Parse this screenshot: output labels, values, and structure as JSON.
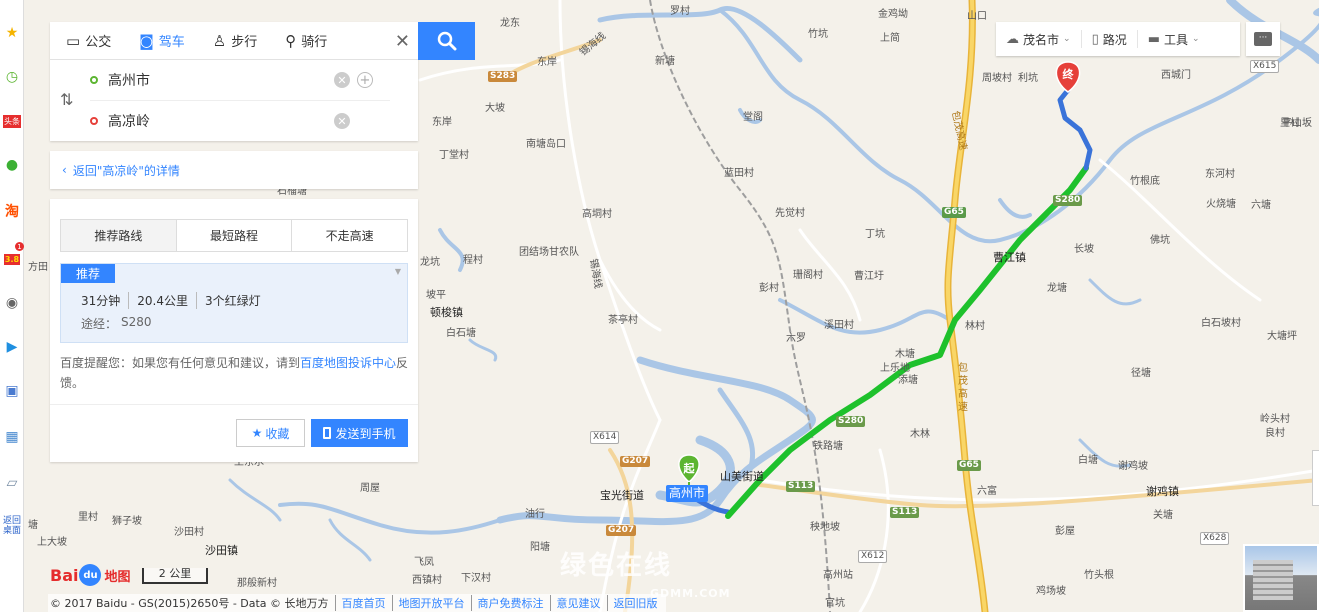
{
  "tabs": {
    "bus": "公交",
    "drive": "驾车",
    "walk": "步行",
    "bike": "骑行"
  },
  "inputs": {
    "origin": "高州市",
    "destination": "高凉岭"
  },
  "back_link": "返回\"高凉岭\"的详情",
  "route_tabs": [
    "推荐路线",
    "最短路程",
    "不走高速"
  ],
  "route": {
    "badge": "推荐",
    "duration": "31分钟",
    "distance": "20.4公里",
    "lights": "3个红绿灯",
    "via_label": "途经：",
    "via_road": "S280"
  },
  "tip": {
    "prefix": "百度提醒您：如果您有任何意见和建议，请到",
    "link": "百度地图投诉中心",
    "suffix": "反馈。"
  },
  "buttons": {
    "favorite": "收藏",
    "send_to_phone": "发送到手机"
  },
  "toolbar": {
    "city": "茂名市",
    "traffic": "路况",
    "tools": "工具"
  },
  "markers": {
    "start": "起",
    "end": "终",
    "origin_label": "高州市"
  },
  "dock": {
    "notice_count": "1",
    "promo": "3.8",
    "taobao": "淘",
    "news": "头条",
    "desktop": "返回桌面"
  },
  "logo": {
    "brand_left": "Bai",
    "brand_paw": "du",
    "brand_right": "地图"
  },
  "scale": "2 公里",
  "footer": {
    "copyright": "© 2017 Baidu - GS(2015)2650号 - Data © 长地万方",
    "links": [
      "百度首页",
      "地图开放平台",
      "商户免费标注",
      "意见建议",
      "返回旧版"
    ]
  },
  "watermark": {
    "main": "绿色在线",
    "sub": "GDMM.COM"
  },
  "map_labels": {
    "towns": [
      "曹江镇",
      "顿梭镇",
      "宝光街道",
      "山美街道",
      "沙田镇",
      "谢鸡镇",
      "高州站"
    ],
    "places": [
      "龙东",
      "罗村",
      "竹坑",
      "金鸡坳",
      "山口",
      "上简",
      "东岸",
      "新塘",
      "大坡",
      "南塘岛口",
      "东岸",
      "丁堂村",
      "石榴塘",
      "堂阁",
      "蓝田村",
      "先觉村",
      "高垌村",
      "团结场甘农队",
      "程村",
      "茶亭村",
      "坡平",
      "白石塘",
      "丁坑",
      "珊阁村",
      "曹江圩",
      "彭村",
      "六罗",
      "溪田村",
      "木塘",
      "上乐地",
      "添塘",
      "铁路塘",
      "木林",
      "林村",
      "龙塘",
      "长坡",
      "佛坑",
      "白石坡村",
      "大塘坪",
      "径塘",
      "岭头村",
      "良村",
      "白塘",
      "谢鸡坡",
      "六富",
      "关塘",
      "秧地坡",
      "彭屋",
      "竹头根",
      "鸡场坡",
      "官坑",
      "下汉村",
      "西镇村",
      "飞凤",
      "阳塘",
      "油行",
      "那般新村",
      "沙田村",
      "狮子坡",
      "里村",
      "上大坡",
      "塘",
      "周屋",
      "土东水",
      "里村",
      "周坡村",
      "利坑",
      "西城门",
      "平山坂",
      "竹根底",
      "东河村",
      "火烧塘",
      "六塘",
      "包茂高速",
      "方田",
      "龙坑",
      "包茂高速",
      "锡海线",
      "锡海线"
    ],
    "shields": {
      "s283": "S283",
      "g65a": "G65",
      "s280a": "S280",
      "s280b": "S280",
      "g65b": "G65",
      "s113a": "S113",
      "s113b": "S113",
      "g207a": "G207",
      "g207b": "G207",
      "x614": "X614",
      "x615": "X615",
      "x612": "X612",
      "x628": "X628"
    }
  },
  "colors": {
    "accent": "#3385ff",
    "route": "#1ec12c",
    "water": "#aac6e6",
    "expressway": "#f6c64a",
    "start_marker": "#5cb531",
    "end_marker": "#e6403a"
  }
}
